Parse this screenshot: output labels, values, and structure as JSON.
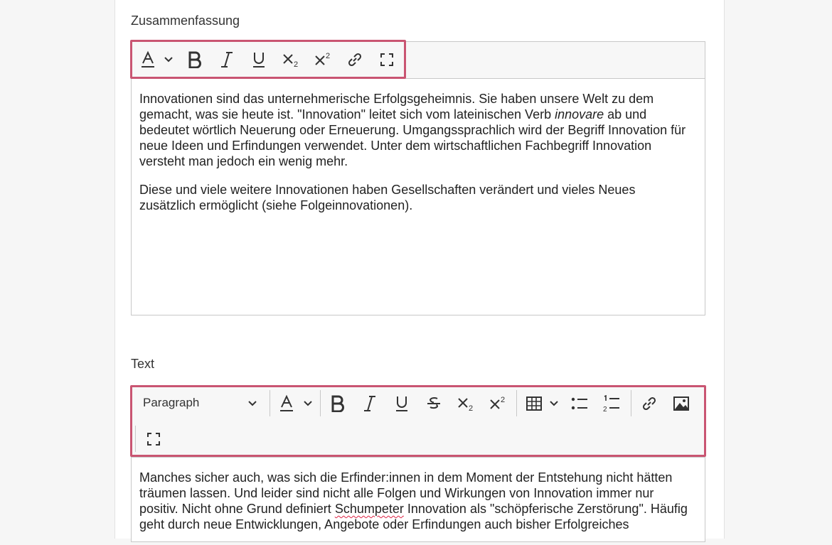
{
  "summary": {
    "label": "Zusammenfassung",
    "icons": [
      "text-color-icon",
      "chevron-down-icon",
      "bold-icon",
      "italic-icon",
      "underline-icon",
      "subscript-icon",
      "superscript-icon",
      "link-icon",
      "fullscreen-icon"
    ],
    "p1_a": "Innovationen sind das unternehmerische Erfolgsgeheimnis. Sie haben unsere Welt zu dem gemacht, was sie heute ist. \"Innovation\" leitet sich vom lateinischen Verb ",
    "p1_em": "innovare",
    "p1_b": " ab und bedeutet wörtlich Neuerung oder Erneuerung. Umgangssprachlich wird der Begriff Innovation für neue Ideen und Erfindungen verwendet. Unter dem wirtschaftlichen Fachbegriff Innovation versteht man jedoch ein wenig mehr.",
    "p2": "Diese und viele weitere Innovationen haben Gesellschaften verändert und vieles Neues zusätzlich ermöglicht (siehe Folgeinnovationen)."
  },
  "text": {
    "label": "Text",
    "paragraph_select": "Paragraph",
    "icons": [
      "text-color-icon",
      "bold-icon",
      "italic-icon",
      "underline-icon",
      "strikethrough-icon",
      "subscript-icon",
      "superscript-icon",
      "table-icon",
      "bullet-list-icon",
      "numbered-list-icon",
      "link-icon",
      "image-icon",
      "fullscreen-icon"
    ],
    "p1_a": "Manches sicher auch, was sich die Erfinder:innen in dem Moment der Entstehung nicht hätten träumen lassen. Und leider sind nicht alle Folgen und Wirkungen von Innovation immer nur positiv. Nicht ohne Grund definiert ",
    "p1_spell": "Schumpeter",
    "p1_b": " Innovation als \"schöpferische Zerstörung\". Häufig geht durch neue Entwicklungen, Angebote oder Erfindungen auch bisher Erfolgreiches"
  },
  "colors": {
    "highlight": "#c95572",
    "toolbar_bg": "#f7f7f7",
    "border": "#c8c8c8"
  }
}
